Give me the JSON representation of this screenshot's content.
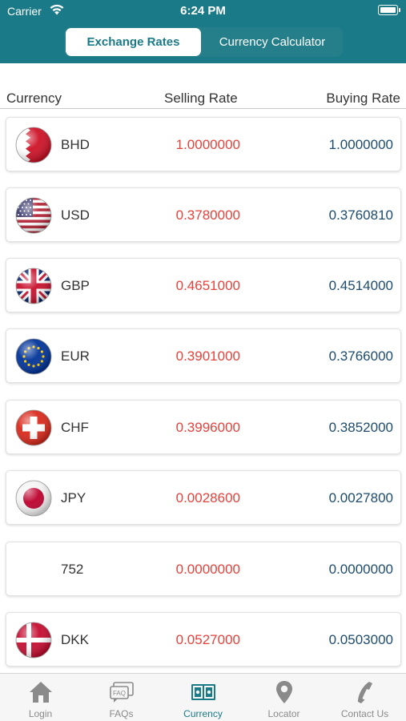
{
  "status_bar": {
    "carrier": "Carrier",
    "time": "6:24 PM"
  },
  "segment": {
    "active": "Exchange Rates",
    "inactive": "Currency Calculator"
  },
  "columns": {
    "currency": "Currency",
    "selling": "Selling Rate",
    "buying": "Buying Rate"
  },
  "rates": [
    {
      "code": "BHD",
      "sell": "1.0000000",
      "buy": "1.0000000",
      "flag": "bahrain-flag"
    },
    {
      "code": "USD",
      "sell": "0.3780000",
      "buy": "0.3760810",
      "flag": "usa-flag"
    },
    {
      "code": "GBP",
      "sell": "0.4651000",
      "buy": "0.4514000",
      "flag": "uk-flag"
    },
    {
      "code": "EUR",
      "sell": "0.3901000",
      "buy": "0.3766000",
      "flag": "eu-flag"
    },
    {
      "code": "CHF",
      "sell": "0.3996000",
      "buy": "0.3852000",
      "flag": "swiss-flag"
    },
    {
      "code": "JPY",
      "sell": "0.0028600",
      "buy": "0.0027800",
      "flag": "japan-flag"
    },
    {
      "code": "752",
      "sell": "0.0000000",
      "buy": "0.0000000",
      "flag": ""
    },
    {
      "code": "DKK",
      "sell": "0.0527000",
      "buy": "0.0503000",
      "flag": "denmark-flag"
    }
  ],
  "tabs": [
    {
      "label": "Login",
      "icon": "home-icon"
    },
    {
      "label": "FAQs",
      "icon": "faq-icon",
      "icon_text": "FAQ"
    },
    {
      "label": "Currency",
      "icon": "currency-icon",
      "active": true
    },
    {
      "label": "Locator",
      "icon": "location-pin-icon"
    },
    {
      "label": "Contact Us",
      "icon": "phone-icon"
    }
  ],
  "colors": {
    "header": "#1b7a87",
    "sell": "#e5423b",
    "buy": "#1d4c6e",
    "tab_active": "#1b7a87",
    "tab_inactive": "#8a8a8a"
  }
}
